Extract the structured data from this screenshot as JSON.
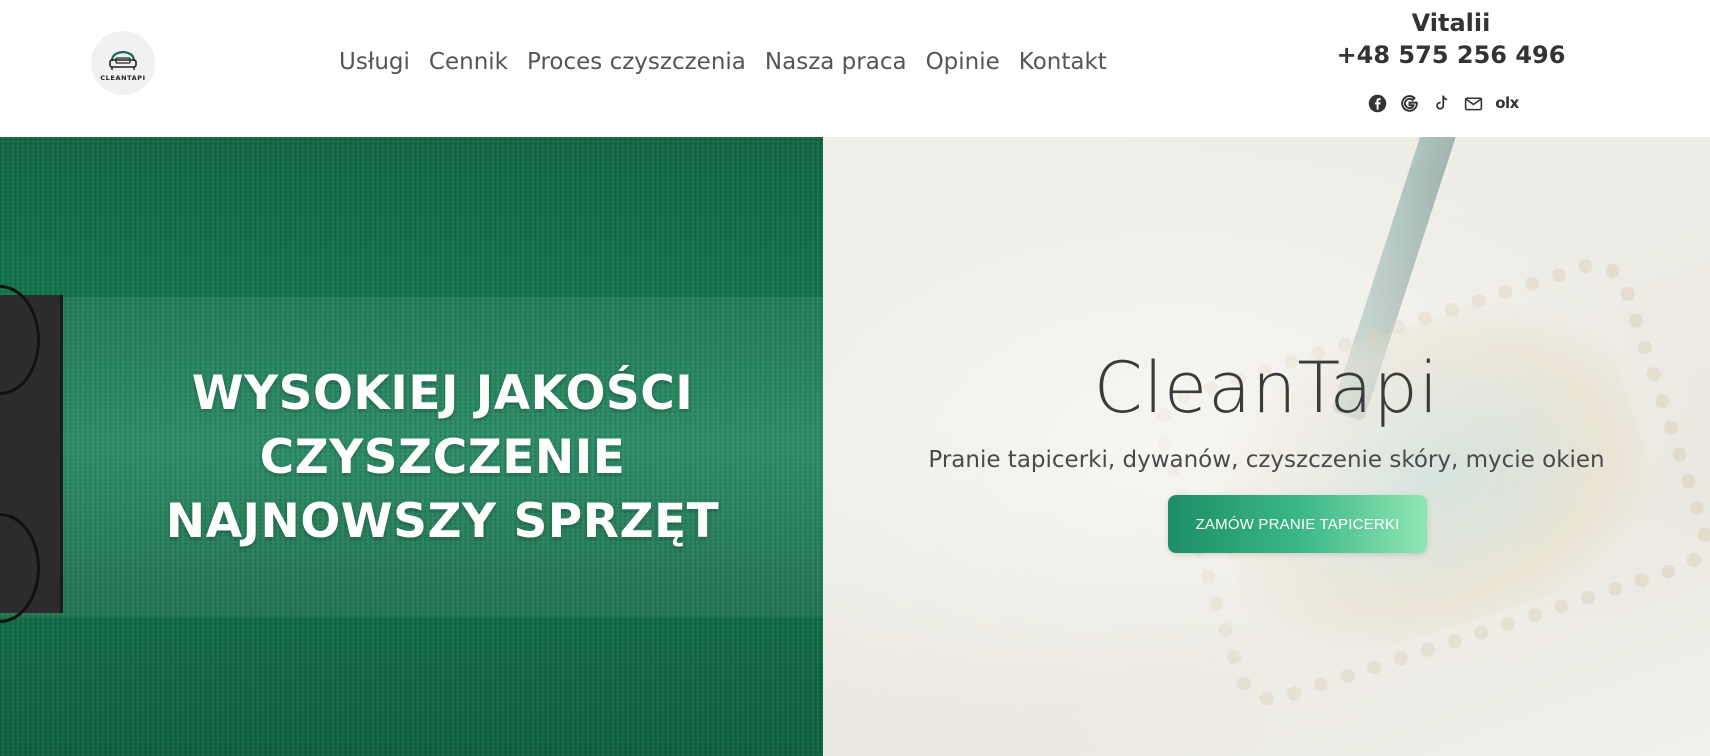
{
  "logo": {
    "text": "CLEANTAPI"
  },
  "nav": {
    "items": [
      {
        "label": "Usługi"
      },
      {
        "label": "Cennik"
      },
      {
        "label": "Proces czyszczenia"
      },
      {
        "label": "Nasza praca"
      },
      {
        "label": "Opinie"
      },
      {
        "label": "Kontakt"
      }
    ]
  },
  "contact": {
    "name": "Vitalii",
    "phone": "+48 575 256 496",
    "socials": [
      "facebook-icon",
      "google-icon",
      "tiktok-icon",
      "mail-icon",
      "olx-icon"
    ],
    "olx_label": "olx"
  },
  "hero_left": {
    "lines": [
      "WYSOKIEJ JAKOŚCI",
      "CZYSZCZENIE",
      "NAJNOWSZY SPRZĘT"
    ]
  },
  "hero_right": {
    "brand": "CleanTapi",
    "tagline": "Pranie tapicerki, dywanów, czyszczenie skóry, mycie okien",
    "cta_label": "ZAMÓW PRANIE TAPICERKI"
  },
  "colors": {
    "green_dark": "#0e6b44",
    "cta_start": "#1c8e66",
    "cta_end": "#8fe6b4",
    "text_dark": "#333333"
  }
}
